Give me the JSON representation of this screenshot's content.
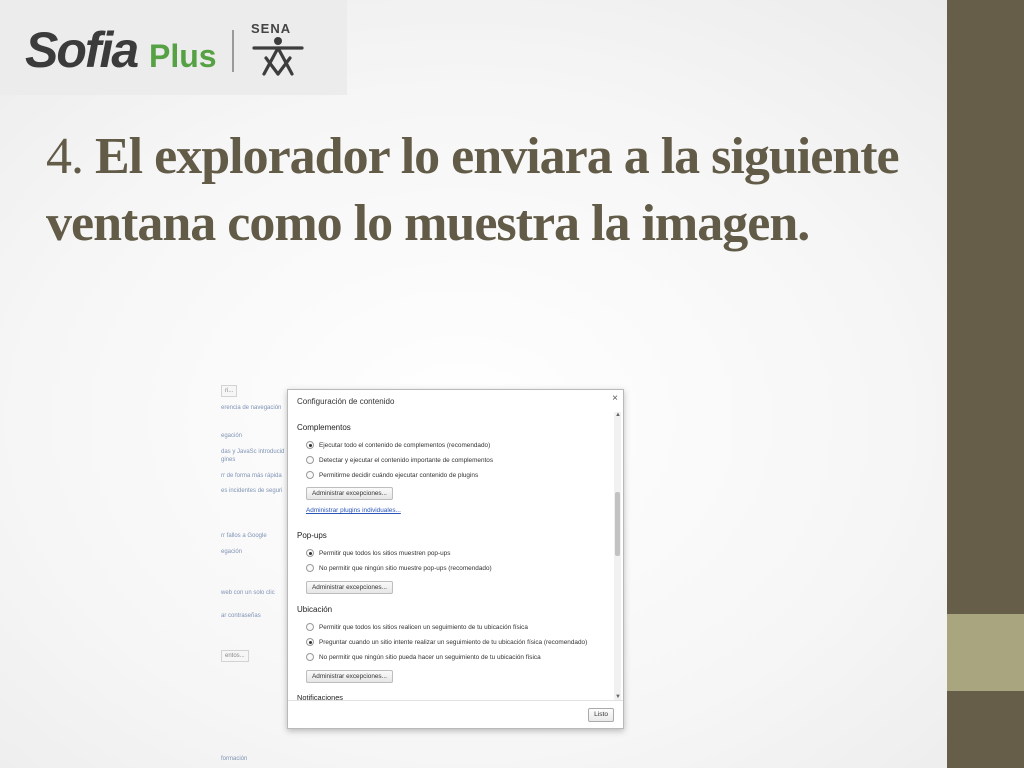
{
  "logo": {
    "sofia": "Sofia",
    "plus": "Plus",
    "sena": "SENA"
  },
  "slide": {
    "number": "4.",
    "title": "El explorador lo enviara a la siguiente ventana como lo muestra la imagen."
  },
  "colors": {
    "sidebar_dark": "#665e49",
    "sidebar_light": "#a9a67f",
    "title": "#625b47",
    "plus_green": "#56a144"
  },
  "background_page": {
    "lines": [
      "erencia de navegación",
      "egación",
      "das y JavaSc introducid",
      "gines",
      "rr de forma más rápida",
      "es incidentes de seguri",
      "rr fallos a Google",
      "egación",
      "web con un solo clic",
      "ar contraseñas",
      "formación"
    ],
    "buttons": [
      "ri...",
      "entos..."
    ]
  },
  "dialog": {
    "title": "Configuración de contenido",
    "close": "×",
    "sections": {
      "complementos": {
        "heading": "Complementos",
        "options": [
          "Ejecutar todo el contenido de complementos (recomendado)",
          "Detectar y ejecutar el contenido importante de complementos",
          "Permitirme decidir cuándo ejecutar contenido de plugins"
        ],
        "button": "Administrar excepciones...",
        "link": "Administrar plugins individuales..."
      },
      "popups": {
        "heading": "Pop-ups",
        "options": [
          "Permitir que todos los sitios muestren pop-ups",
          "No permitir que ningún sitio muestre pop-ups (recomendado)"
        ],
        "button": "Administrar excepciones..."
      },
      "ubicacion": {
        "heading": "Ubicación",
        "options": [
          "Permitir que todos los sitios realicen un seguimiento de tu ubicación física",
          "Preguntar cuando un sitio intente realizar un seguimiento de tu ubicación física (recomendado)",
          "No permitir que ningún sitio pueda hacer un seguimiento de tu ubicación física"
        ],
        "button": "Administrar excepciones..."
      },
      "notificaciones": {
        "heading": "Notificaciones"
      }
    },
    "done_button": "Listo"
  }
}
